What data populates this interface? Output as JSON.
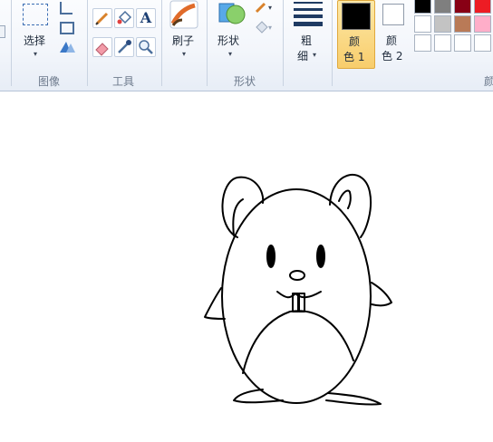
{
  "ribbon": {
    "select_label": "选择",
    "groups": {
      "image": "图像",
      "tools": "工具",
      "shapes": "形状",
      "colors_partial": "颜"
    },
    "brush_label": "刷子",
    "shape_label": "形状",
    "size_label_line1": "粗",
    "size_label_line2": "细",
    "color1_line1": "颜",
    "color1_line2": "色 1",
    "color2_line1": "颜",
    "color2_line2": "色 2",
    "text_tool_glyph": "A",
    "palette_row1": [
      "#000000",
      "#7f7f7f",
      "#880015",
      "#ed1c24"
    ],
    "palette_row2": [
      "#ffffff",
      "#c3c3c3",
      "#b97a57",
      "#ffaec9"
    ],
    "palette_row3": [
      "#ffffff",
      "#ffffff",
      "#ffffff",
      "#ffffff"
    ],
    "color1_value": "#000000",
    "color2_value": "#ffffff"
  },
  "canvas": {
    "drawing": "hamster-sketch"
  }
}
